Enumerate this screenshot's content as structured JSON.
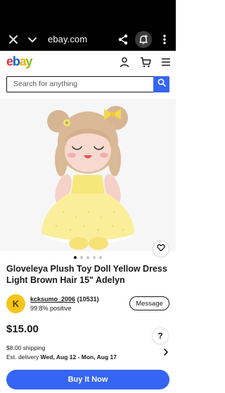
{
  "browser": {
    "url": "ebay.com"
  },
  "header": {
    "logo_letters": [
      "e",
      "b",
      "a",
      "y"
    ],
    "icons": [
      "user-icon",
      "cart-icon",
      "menu-icon"
    ]
  },
  "search": {
    "placeholder": "Search for anything",
    "value": ""
  },
  "carousel": {
    "image_count": 5,
    "active_index": 0
  },
  "item": {
    "title": "Gloveleya Plush Toy Doll Yellow Dress Light Brown Hair 15\" Adelyn",
    "price": "$15.00"
  },
  "seller": {
    "avatar_letter": "K",
    "username": "kcksumo_2006",
    "feedback_score": "(10531)",
    "positive": "99.8% positive",
    "message_label": "Message"
  },
  "shipping": {
    "cost": "$8.00 shipping",
    "delivery_prefix": "Est. delivery",
    "delivery_dates": "Wed, Aug 12 - Mon, Aug 17"
  },
  "actions": {
    "help_label": "?",
    "buy_now_label": "Buy It Now"
  },
  "colors": {
    "primary_blue": "#3665f3",
    "logo_red": "#e53238",
    "logo_blue": "#0064d2",
    "logo_yellow": "#f5af02",
    "logo_green": "#86b817",
    "avatar_yellow": "#f5c518"
  }
}
